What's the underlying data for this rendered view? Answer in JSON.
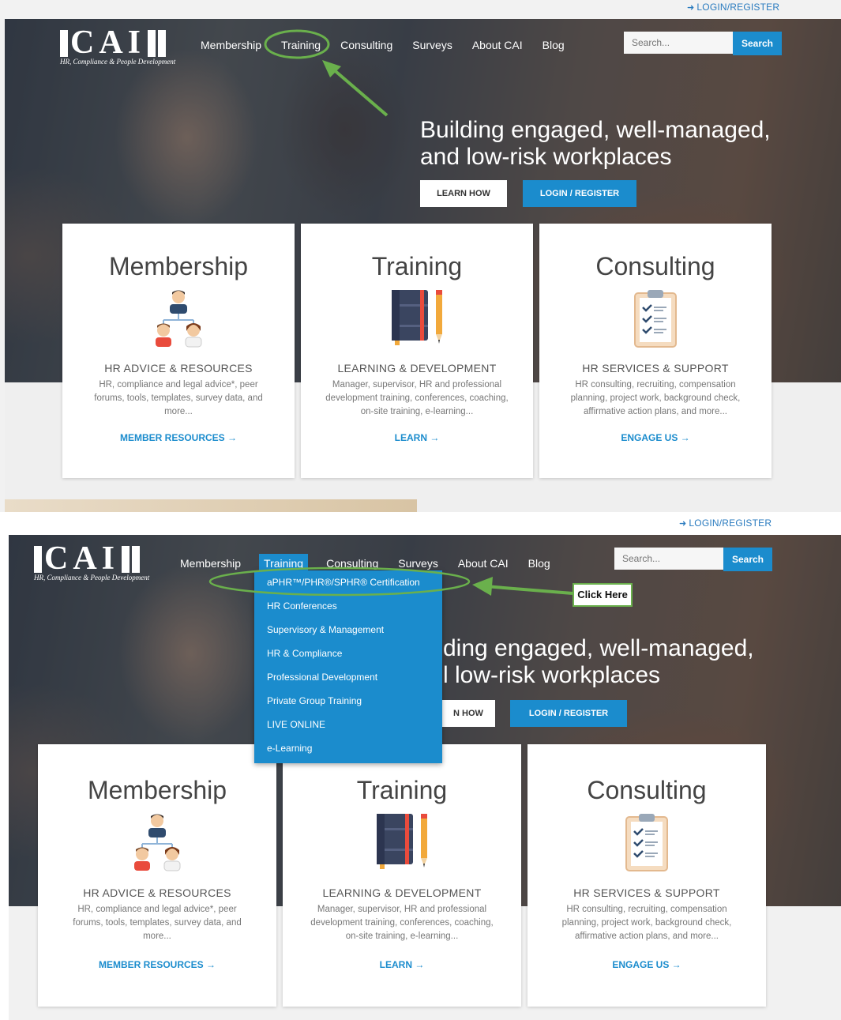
{
  "site": {
    "login_link": "LOGIN/REGISTER",
    "logo_letters": "CAI",
    "logo_tagline": "HR, Compliance & People Development",
    "nav": [
      "Membership",
      "Training",
      "Consulting",
      "Surveys",
      "About CAI",
      "Blog"
    ],
    "search_placeholder": "Search...",
    "search_button": "Search",
    "headline_line1": "Building engaged, well-managed,",
    "headline_line2": "and low-risk workplaces",
    "headline_line1_clipped": "ding engaged, well-managed,",
    "headline_line2_clipped": "l low-risk workplaces",
    "learn_how": "LEARN HOW",
    "learn_how_clipped": "N HOW",
    "login_register_btn": "LOGIN / REGISTER"
  },
  "cards": [
    {
      "title": "Membership",
      "icon": "people-org-icon",
      "subtitle": "HR ADVICE & RESOURCES",
      "desc1": "HR, compliance and legal advice*, peer",
      "desc2": "forums, tools, templates, survey data, and",
      "desc3": "more...",
      "link": "MEMBER RESOURCES →"
    },
    {
      "title": "Training",
      "icon": "notebook-pencil-icon",
      "subtitle": "LEARNING & DEVELOPMENT",
      "desc1": "Manager, supervisor, HR and professional",
      "desc2": "development training, conferences, coaching,",
      "desc3": "on-site training, e-learning...",
      "link": "LEARN →"
    },
    {
      "title": "Consulting",
      "icon": "clipboard-checklist-icon",
      "subtitle": "HR SERVICES & SUPPORT",
      "desc1": "HR consulting, recruiting, compensation",
      "desc2": "planning, project work, background check,",
      "desc3": "affirmative action plans, and more...",
      "link": "ENGAGE US →"
    }
  ],
  "training_menu": [
    "aPHR™/PHR®/SPHR® Certification",
    "HR Conferences",
    "Supervisory & Management",
    "HR & Compliance",
    "Professional Development",
    "Private Group Training",
    "LIVE ONLINE",
    "e-Learning"
  ],
  "callout": "Click Here",
  "colors": {
    "brand_blue": "#1b8ccd",
    "annotation_green": "#6ab04c"
  }
}
